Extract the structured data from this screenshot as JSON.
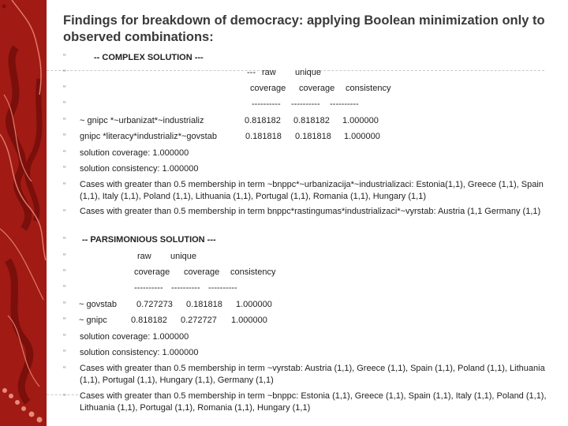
{
  "slide": {
    "title": "Findings for breakdown of democracy: applying Boolean minimization only to observed combinations:",
    "bullet_glyph": "“",
    "complex": {
      "heading": "-- COMPLEX SOLUTION ---",
      "header_row1": {
        "prefix": "---",
        "raw": "raw",
        "unique": "unique"
      },
      "header_row2": {
        "raw": "coverage",
        "unique": "coverage",
        "consistency": "consistency"
      },
      "separator": {
        "raw": "----------",
        "unique": "----------",
        "consistency": "----------"
      },
      "terms": [
        {
          "term": "~ gnipc *~urbanizat*~industrializ",
          "raw": "0.818182",
          "unique": "0.818182",
          "consistency": "1.000000"
        },
        {
          "term": "gnipc *literacy*industrializ*~govstab",
          "raw": "0.181818",
          "unique": "0.181818",
          "consistency": "1.000000"
        }
      ],
      "solution_coverage": "solution coverage: 1.000000",
      "solution_consistency": "solution consistency: 1.000000",
      "cases": [
        "Cases with greater than 0.5 membership in term ~bnppc*~urbanizacija*~industrializaci: Estonia(1,1),    Greece (1,1), Spain (1,1), Italy (1,1),   Poland (1,1), Lithuania (1,1), Portugal (1,1),    Romania (1,1), Hungary (1,1)",
        "Cases with greater than 0.5 membership in term bnppc*rastingumas*industrializaci*~vyrstab: Austria (1,1 Germany (1,1)"
      ]
    },
    "parsimonious": {
      "heading": "-- PARSIMONIOUS SOLUTION ---",
      "header_row1": {
        "raw": "raw",
        "unique": "unique"
      },
      "header_row2": {
        "raw": "coverage",
        "unique": "coverage",
        "consistency": "consistency"
      },
      "separator": {
        "raw": "----------",
        "unique": "----------",
        "consistency": "----------"
      },
      "terms": [
        {
          "term": "~ govstab",
          "raw": "0.727273",
          "unique": "0.181818",
          "consistency": "1.000000"
        },
        {
          "term": "~ gnipc",
          "raw": "0.818182",
          "unique": "0.272727",
          "consistency": "1.000000"
        }
      ],
      "solution_coverage": "solution coverage: 1.000000",
      "solution_consistency": "solution consistency: 1.000000",
      "cases": [
        "Cases with greater than 0.5 membership in term ~vyrstab:  Austria (1,1),    Greece (1,1), Spain (1,1), Poland (1,1), Lithuania (1,1), Portugal (1,1), Hungary (1,1),  Germany (1,1)",
        "Cases with greater than 0.5 membership in term ~bnppc: Estonia (1,1),    Greece (1,1), Spain (1,1), Italy (1,1), Poland (1,1), Lithuania (1,1), Portugal (1,1),    Romania (1,1), Hungary (1,1)"
      ]
    }
  },
  "colors": {
    "side_band": "#a11a14",
    "title_text": "#3a3a3a",
    "body_text": "#222222"
  }
}
